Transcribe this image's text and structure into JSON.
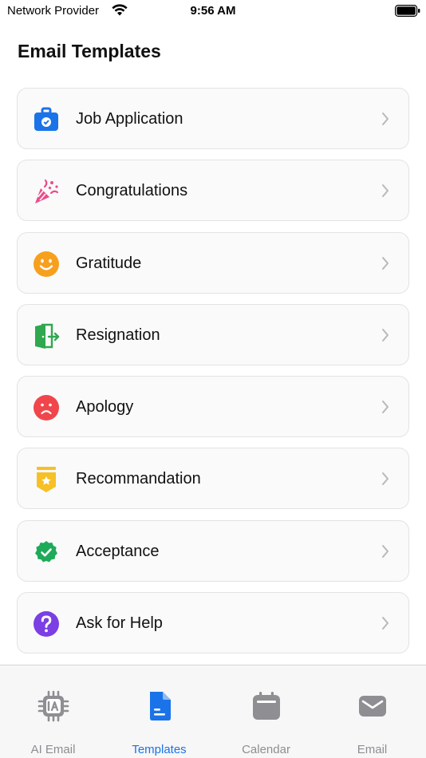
{
  "status_bar": {
    "carrier": "Network Provider",
    "time": "9:56 AM"
  },
  "page": {
    "title": "Email Templates"
  },
  "templates": [
    {
      "label": "Job Application",
      "icon": "briefcase-icon",
      "color": "#1a73e8"
    },
    {
      "label": "Congratulations",
      "icon": "party-popper-icon",
      "color": "#e94d8a"
    },
    {
      "label": "Gratitude",
      "icon": "smile-icon",
      "color": "#f7a01e"
    },
    {
      "label": "Resignation",
      "icon": "exit-door-icon",
      "color": "#2fa84f"
    },
    {
      "label": "Apology",
      "icon": "sad-face-icon",
      "color": "#f0464b"
    },
    {
      "label": "Recommandation",
      "icon": "award-badge-icon",
      "color": "#f6c026"
    },
    {
      "label": "Acceptance",
      "icon": "verified-check-icon",
      "color": "#1faa59"
    },
    {
      "label": "Ask for Help",
      "icon": "question-icon",
      "color": "#7b3fe4"
    }
  ],
  "tab_bar": {
    "active_color": "#1a73e8",
    "inactive_color": "#8e8e93",
    "tabs": [
      {
        "label": "AI Email",
        "icon": "ai-chip-icon",
        "active": false
      },
      {
        "label": "Templates",
        "icon": "document-icon",
        "active": true
      },
      {
        "label": "Calendar",
        "icon": "calendar-icon",
        "active": false
      },
      {
        "label": "Email",
        "icon": "envelope-icon",
        "active": false
      }
    ]
  }
}
